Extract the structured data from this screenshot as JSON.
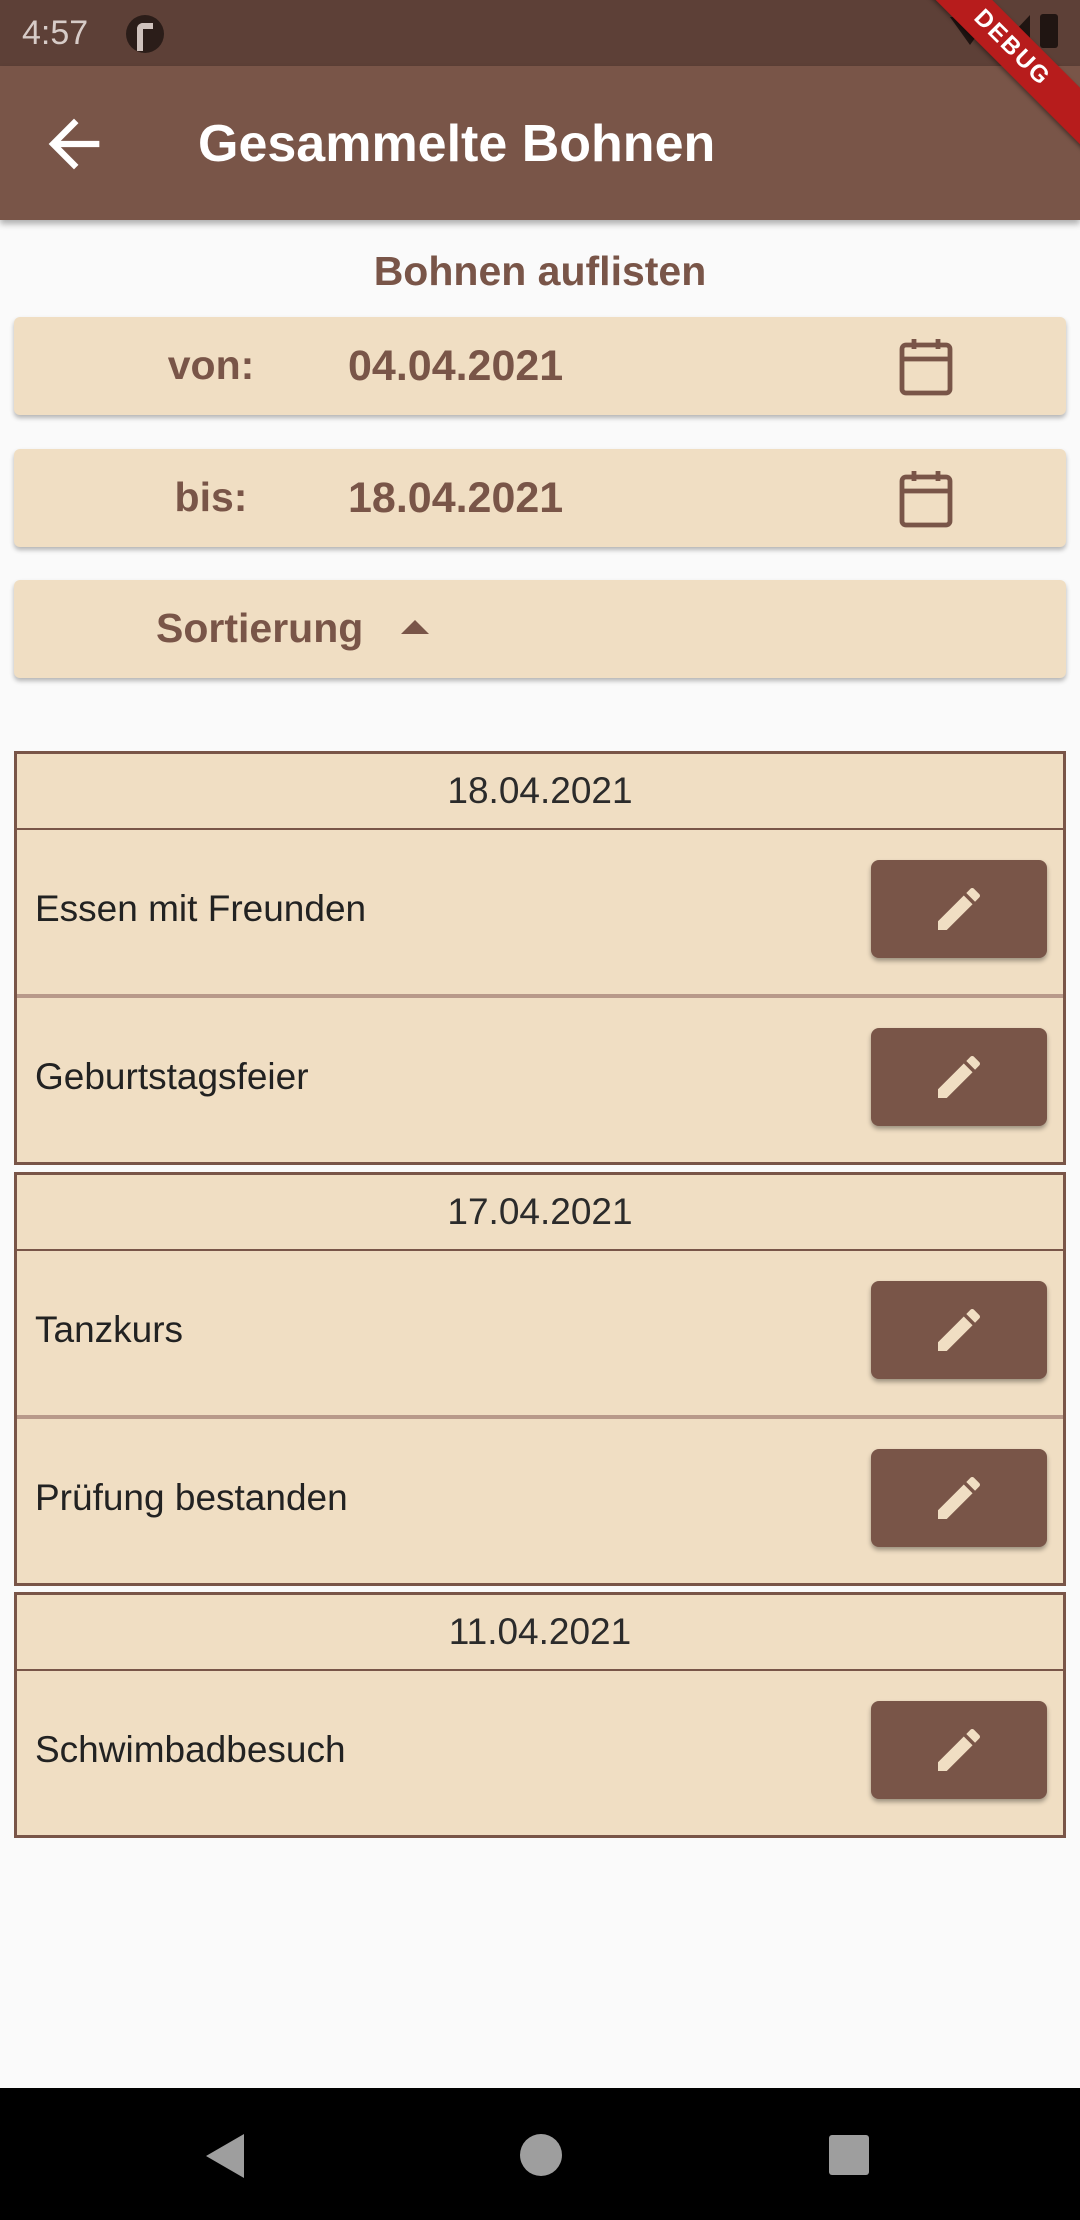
{
  "status_bar": {
    "time": "4:57"
  },
  "app_bar": {
    "title": "Gesammelte Bohnen",
    "debug_label": "DEBUG"
  },
  "section_title": "Bohnen auflisten",
  "filters": {
    "from": {
      "label": "von:",
      "date": "04.04.2021"
    },
    "to": {
      "label": "bis:",
      "date": "18.04.2021"
    },
    "sort": {
      "label": "Sortierung"
    }
  },
  "groups": [
    {
      "date": "18.04.2021",
      "entries": [
        {
          "name": "Essen mit Freunden"
        },
        {
          "name": "Geburtstagsfeier"
        }
      ]
    },
    {
      "date": "17.04.2021",
      "entries": [
        {
          "name": "Tanzkurs"
        },
        {
          "name": "Prüfung bestanden"
        }
      ]
    },
    {
      "date": "11.04.2021",
      "entries": [
        {
          "name": "Schwimbadbesuch"
        }
      ]
    }
  ],
  "colors": {
    "primary": "#795548",
    "card": "#f0dec3",
    "status_bar": "#5d4037",
    "background": "#fafafa"
  }
}
